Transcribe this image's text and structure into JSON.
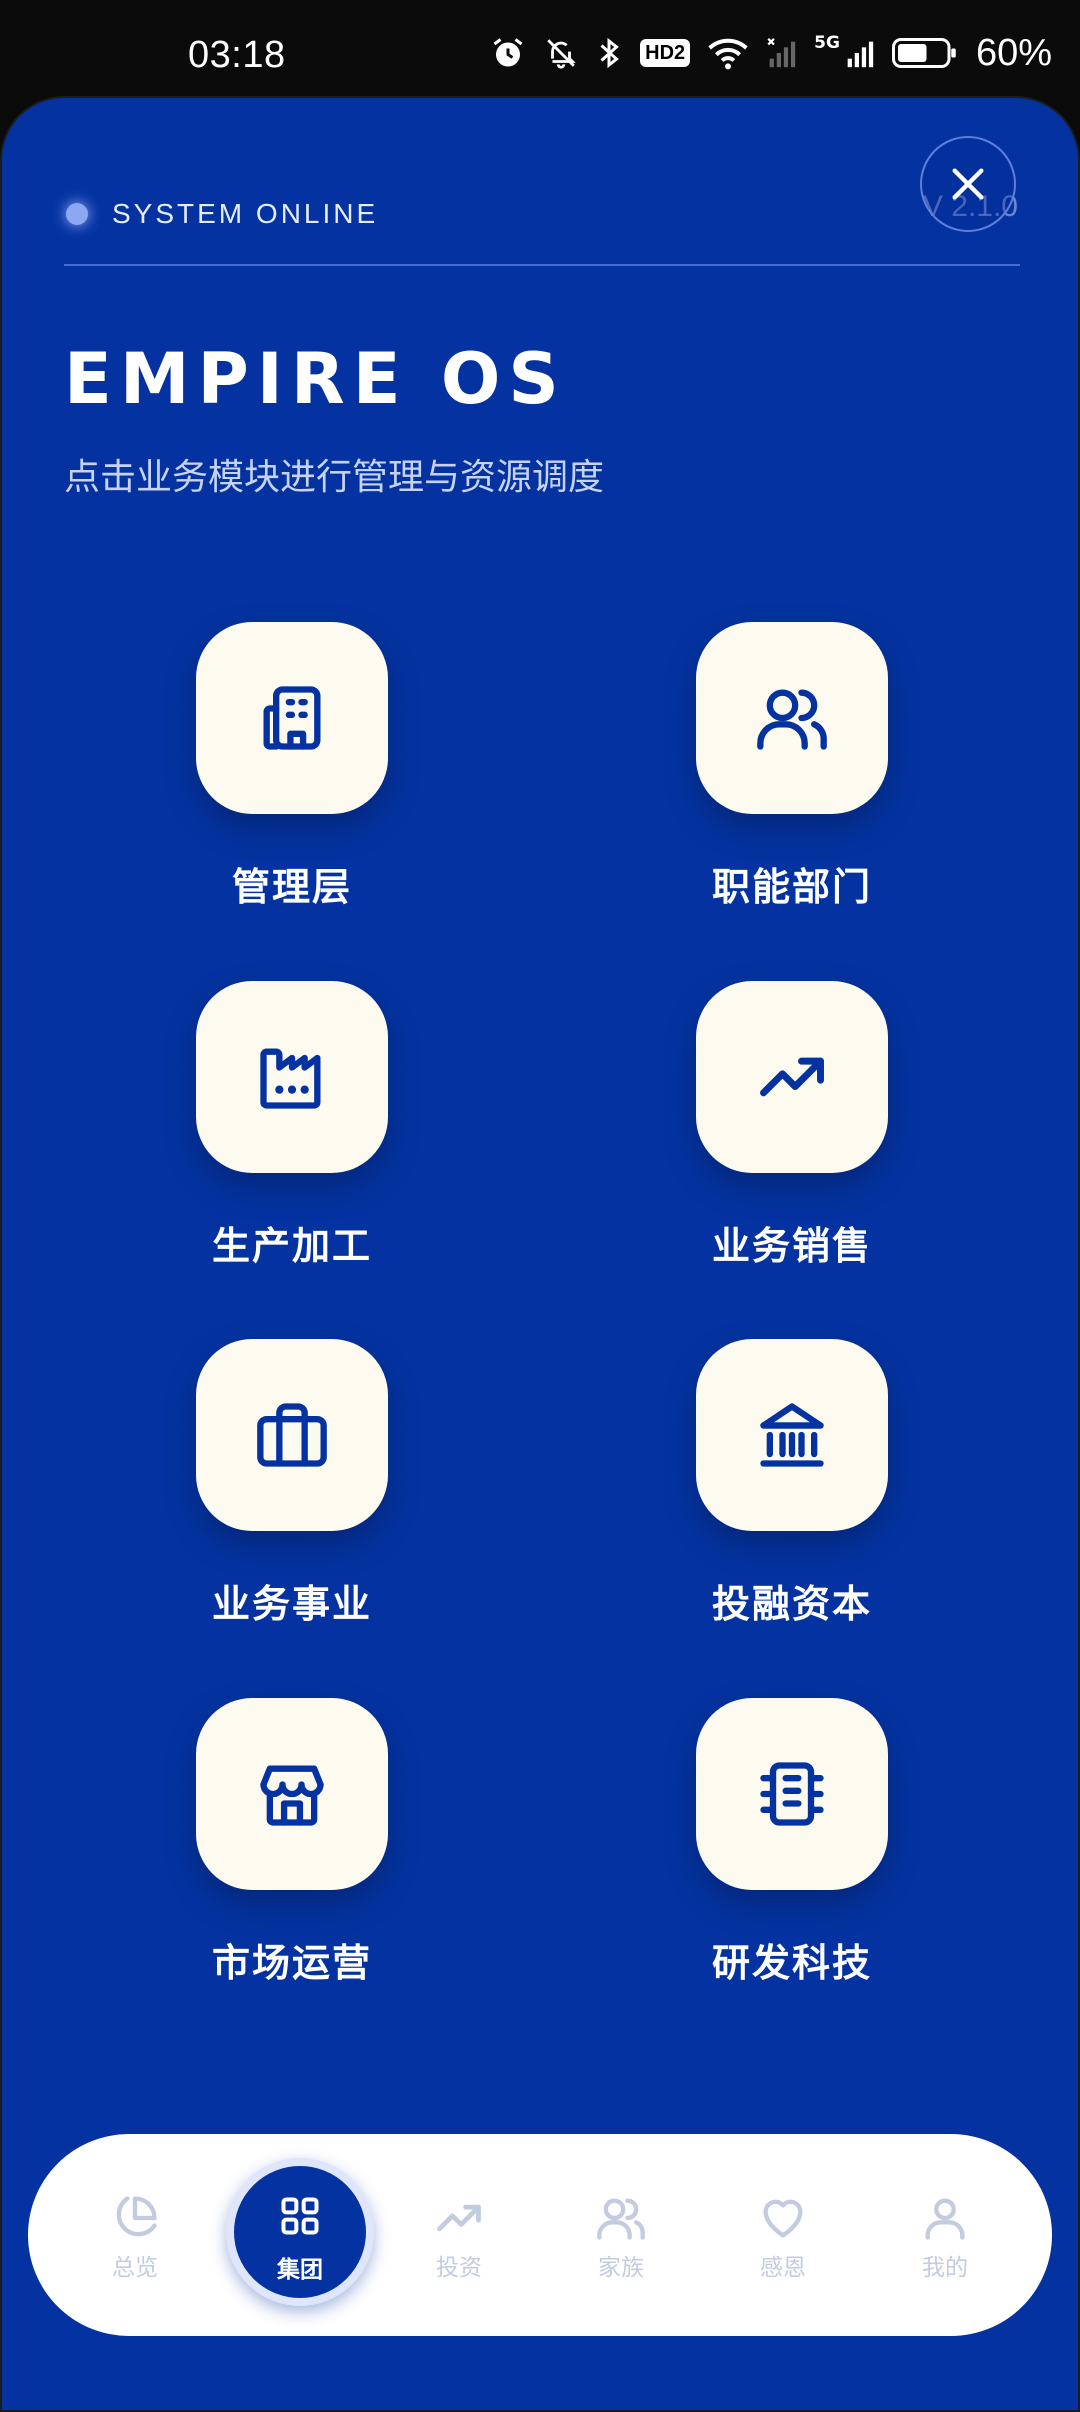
{
  "status_bar": {
    "time": "03:18",
    "hd_badge": "HD2",
    "network_type": "5G",
    "battery_percent": "60%",
    "icons": [
      "alarm-icon",
      "mute-bell-icon",
      "bluetooth-icon",
      "hd-voice-icon",
      "wifi-icon",
      "signal-no-sim-icon",
      "signal-5g-icon",
      "battery-icon"
    ]
  },
  "header": {
    "system_status": "SYSTEM ONLINE",
    "version": "V 2.1.0",
    "title": "EMPIRE OS",
    "subtitle": "点击业务模块进行管理与资源调度"
  },
  "modules": [
    {
      "label": "管理层",
      "icon": "building-icon"
    },
    {
      "label": "职能部门",
      "icon": "users-icon"
    },
    {
      "label": "生产加工",
      "icon": "factory-icon"
    },
    {
      "label": "业务销售",
      "icon": "trending-up-icon"
    },
    {
      "label": "业务事业",
      "icon": "briefcase-icon"
    },
    {
      "label": "投融资本",
      "icon": "bank-icon"
    },
    {
      "label": "市场运营",
      "icon": "store-icon"
    },
    {
      "label": "研发科技",
      "icon": "chip-icon"
    }
  ],
  "bottom_nav": {
    "items": [
      {
        "label": "总览",
        "icon": "pie-chart-icon"
      },
      {
        "label": "集团",
        "icon": "grid-icon",
        "active": true
      },
      {
        "label": "投资",
        "icon": "trending-up-icon"
      },
      {
        "label": "家族",
        "icon": "users-icon"
      },
      {
        "label": "感恩",
        "icon": "heart-icon"
      },
      {
        "label": "我的",
        "icon": "user-icon"
      }
    ]
  },
  "colors": {
    "sheet_background": "#0433a1",
    "tile_background": "#fdfaf0",
    "icon_color": "#0433a1",
    "nav_inactive": "#c2cbe0"
  }
}
